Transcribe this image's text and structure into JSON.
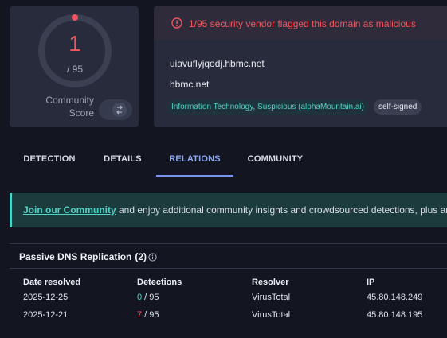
{
  "score": {
    "value": "1",
    "total": "/ 95",
    "community_line1": "Community",
    "community_line2": "Score",
    "gauge_fraction": 0.0105
  },
  "alert": {
    "icon": "alert-circle-icon",
    "text": "1/95 security vendor flagged this domain as malicious"
  },
  "domain": {
    "full": "uiavuflyjqodj.hbmc.net",
    "parent": "hbmc.net",
    "tags": [
      "Information Technology, Suspicious (alphaMountain.ai)",
      "self-signed"
    ]
  },
  "tabs": [
    "DETECTION",
    "DETAILS",
    "RELATIONS",
    "COMMUNITY"
  ],
  "active_tab": "RELATIONS",
  "banner": {
    "link": "Join our Community",
    "text": " and enjoy additional community insights and crowdsourced detections, plus an"
  },
  "dns": {
    "title": "Passive DNS Replication",
    "count": "(2)",
    "columns": [
      "Date resolved",
      "Detections",
      "Resolver",
      "IP"
    ],
    "rows": [
      {
        "date": "2025-12-25",
        "detections": "0",
        "total": " / 95",
        "resolver": "VirusTotal",
        "ip": "45.80.148.249"
      },
      {
        "date": "2025-12-21",
        "detections": "7",
        "total": " / 95",
        "resolver": "VirusTotal",
        "ip": "45.80.148.195"
      }
    ]
  },
  "colors": {
    "danger": "#f2545b",
    "accent": "#4fd1c5",
    "tab_active": "#8ca6f5"
  }
}
